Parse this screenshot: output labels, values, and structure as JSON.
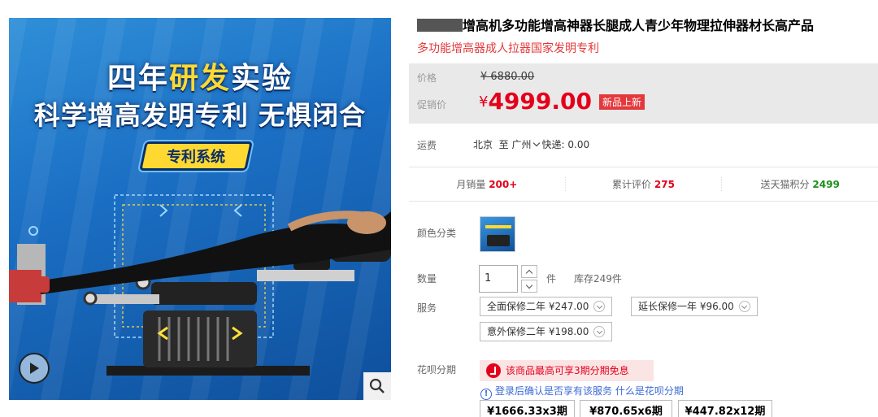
{
  "gallery": {
    "line1_a": "四年",
    "line1_hl": "研发",
    "line1_b": "实验",
    "line2": "科学增高发明专利 无惧闭合",
    "tag": "专利系统"
  },
  "product": {
    "title": "增高机多功能增高神器长腿成人青少年物理拉伸器材长高产品",
    "subtitle": "多功能增高器成人拉器国家发明专利"
  },
  "price": {
    "orig_label": "价格",
    "orig_value": "¥ 6880.00",
    "promo_label": "促销价",
    "currency": "¥",
    "promo_value": "4999.00",
    "badge": "新品上新"
  },
  "shipping": {
    "label": "运费",
    "from": "北京",
    "to_word": "至",
    "city": "广州",
    "method": "快递: 0.00"
  },
  "stats": {
    "sales_label": "月销量",
    "sales_value": "200+",
    "reviews_label": "累计评价",
    "reviews_value": "275",
    "points_label": "送天猫积分",
    "points_value": "2499"
  },
  "options": {
    "color_label": "颜色分类",
    "qty_label": "数量",
    "qty_value": "1",
    "unit": "件",
    "stock": "库存249件",
    "service_label": "服务",
    "services": [
      "全面保修二年 ¥247.00",
      "延长保修一年 ¥96.00",
      "意外保修二年 ¥198.00"
    ],
    "huabei_label": "花呗分期",
    "huabei_promo": "该商品最高可享3期分期免息",
    "login_text": "登录后确认是否享有该服务",
    "what_is": "什么是花呗分期",
    "installments": [
      "¥1666.33x3期",
      "¥870.65x6期",
      "¥447.82x12期"
    ]
  },
  "colors": {
    "accent_red": "#e4001b",
    "link_blue": "#3b6bd6",
    "points_green": "#1f8f1f"
  }
}
